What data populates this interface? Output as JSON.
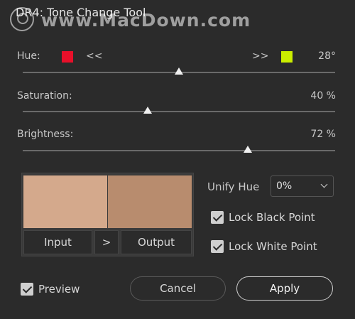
{
  "window": {
    "title": "DR4: Tone Change Tool",
    "watermark": "www.MacDown.com"
  },
  "hue": {
    "label": "Hue:",
    "left_arrow": "<<",
    "right_arrow": ">>",
    "value": "28°",
    "left_color": "#e8102a",
    "right_color": "#ccee00",
    "slider_fraction": 0.5
  },
  "saturation": {
    "label": "Saturation:",
    "value": "40 %",
    "slider_fraction": 0.4
  },
  "brightness": {
    "label": "Brightness:",
    "value": "72 %",
    "slider_fraction": 0.72
  },
  "preview_pane": {
    "input_color": "#d4a98c",
    "output_color": "#b88c6e",
    "input_label": "Input",
    "arrow_label": ">",
    "output_label": "Output"
  },
  "unify_hue": {
    "label": "Unify Hue",
    "selected": "0%"
  },
  "lock_black": {
    "label": "Lock Black Point",
    "checked": true
  },
  "lock_white": {
    "label": "Lock White Point",
    "checked": true
  },
  "preview_toggle": {
    "label": "Preview",
    "checked": true
  },
  "buttons": {
    "cancel": "Cancel",
    "apply": "Apply"
  }
}
